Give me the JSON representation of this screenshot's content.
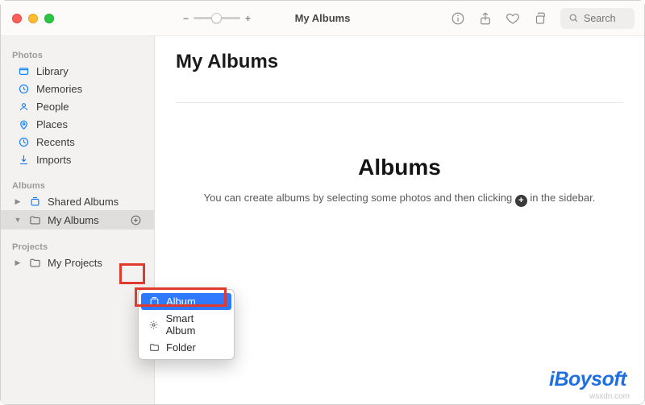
{
  "window": {
    "title": "My Albums"
  },
  "search": {
    "placeholder": "Search"
  },
  "sidebar": {
    "sections": {
      "photos": {
        "header": "Photos"
      },
      "albums": {
        "header": "Albums"
      },
      "projects": {
        "header": "Projects"
      }
    },
    "items": {
      "library": "Library",
      "memories": "Memories",
      "people": "People",
      "places": "Places",
      "recents": "Recents",
      "imports": "Imports",
      "shared_albums": "Shared Albums",
      "my_albums": "My Albums",
      "my_projects": "My Projects"
    }
  },
  "main": {
    "page_title": "My Albums",
    "empty_heading": "Albums",
    "hint_before": "You can create albums by selecting some photos and then clicking ",
    "hint_after": " in the sidebar."
  },
  "context_menu": {
    "album": "Album",
    "smart_album": "Smart Album",
    "folder": "Folder"
  },
  "watermark": {
    "text": "iBoysoft",
    "domain": "wsxdn.com"
  }
}
